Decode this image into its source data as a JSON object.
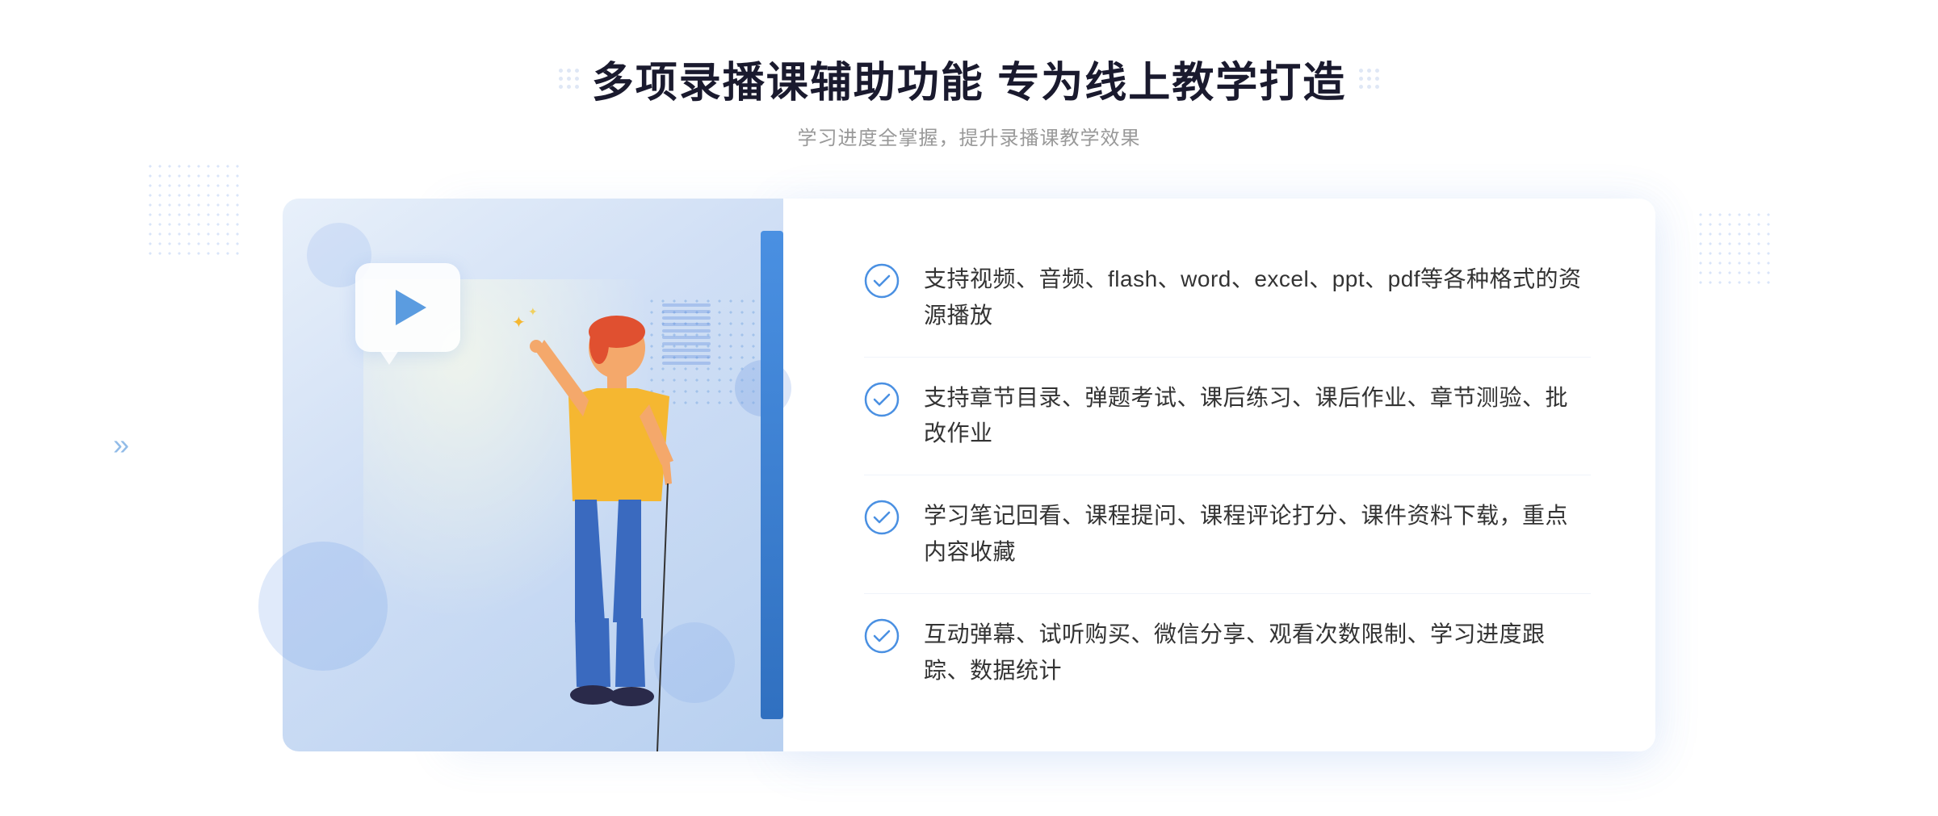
{
  "page": {
    "title": "多项录播课辅助功能 专为线上教学打造",
    "subtitle": "学习进度全掌握，提升录播课教学效果",
    "title_left_dots": "decorative",
    "title_right_dots": "decorative"
  },
  "features": [
    {
      "id": 1,
      "text": "支持视频、音频、flash、word、excel、ppt、pdf等各种格式的资源播放"
    },
    {
      "id": 2,
      "text": "支持章节目录、弹题考试、课后练习、课后作业、章节测验、批改作业"
    },
    {
      "id": 3,
      "text": "学习笔记回看、课程提问、课程评论打分、课件资料下载，重点内容收藏"
    },
    {
      "id": 4,
      "text": "互动弹幕、试听购买、微信分享、观看次数限制、学习进度跟踪、数据统计"
    }
  ],
  "colors": {
    "accent_blue": "#4a90e2",
    "title_color": "#1a1a2e",
    "text_color": "#333333",
    "subtitle_color": "#999999",
    "check_color": "#4a90e2"
  },
  "icons": {
    "check": "circle-check",
    "play": "play-triangle",
    "arrows": "double-chevron"
  }
}
